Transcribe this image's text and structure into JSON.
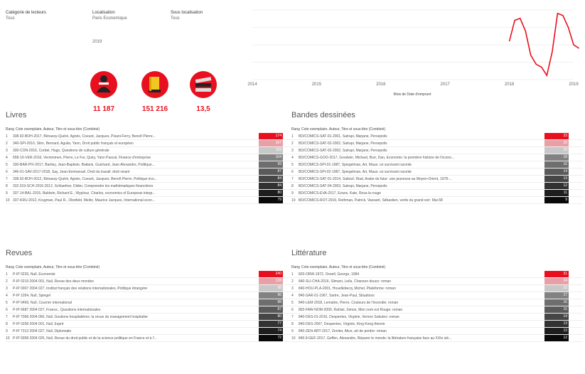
{
  "filters": [
    {
      "label": "Catégorie de lecteurs",
      "value": "Tous"
    },
    {
      "label": "Localisation",
      "value": "Paris Economique"
    },
    {
      "label": "Sous localisation",
      "value": "Tous"
    }
  ],
  "year": "2019",
  "kpis": [
    {
      "icon": "reader-person-icon",
      "value": "11 187"
    },
    {
      "icon": "book-icon",
      "value": "151 216"
    },
    {
      "icon": "books-stack-icon",
      "value": "13,5"
    }
  ],
  "chart_data": {
    "type": "line",
    "x_ticks": [
      "2014",
      "2015",
      "2016",
      "2017",
      "2018",
      "2019"
    ],
    "xlabel": "Mois de Date d'emprunt",
    "color": "#e8101f",
    "x": [
      "2018-01",
      "2018-02",
      "2018-03",
      "2018-04",
      "2018-05",
      "2018-06",
      "2018-07",
      "2018-08",
      "2018-09",
      "2018-10",
      "2018-11",
      "2018-12",
      "2019-01",
      "2019-02"
    ],
    "y": [
      0.55,
      0.85,
      0.88,
      0.7,
      0.35,
      0.22,
      0.18,
      0.06,
      0.4,
      0.95,
      0.92,
      0.75,
      0.5,
      0.45
    ]
  },
  "sections": [
    {
      "title": "Livres",
      "header_rank": "Rang",
      "header_text": "Cote exemplaire, Auteur, Titre et sous-titre (Combiné)",
      "rows": [
        {
          "rank": "1",
          "text": "338.92-BOH-2017, Bénassy-Quéré, Agnès, Coeuré, Jacques, Pisani-Ferry, Benoît Pierre...",
          "value": "174"
        },
        {
          "rank": "2",
          "text": "340-SPI-2016, Stirn, Bernard, Aguila, Yann, Droit public français et européen",
          "value": "167"
        },
        {
          "rank": "3",
          "text": "300-CON-2016, Corbel, Hugo, Questions de culture générale",
          "value": "115"
        },
        {
          "rank": "4",
          "text": "658-19-VER-2016, Vernimmen, Pierre, Le Fur, Quiry, Yann Pascal, Finance d'entreprise",
          "value": "104"
        },
        {
          "rank": "5",
          "text": "330-BAR-PIV-2017, Bartley, Jean-Baptiste, Baltaris, Guichard, Jean Alexandre, Politique...",
          "value": "99"
        },
        {
          "rank": "6",
          "text": "346-01-SAV-2017-2018, Say, Jean-Emmanuel, Droit du travail: droit vivant",
          "value": "87"
        },
        {
          "rank": "7",
          "text": "338.92-BOH-2012, Bénassy-Quéré, Agnès, Coeuré, Jacques, Benoît Pierre, Politique éco...",
          "value": "84"
        },
        {
          "rank": "8",
          "text": "332.019-SCH-2016-2012, Schlaefner, Didier, Comprendre les mathématiques financières",
          "value": "84"
        },
        {
          "rank": "9",
          "text": "337.14-BAL-2015, Baldwin, Richard E., Wyplosz, Charles, economics of European integr...",
          "value": "80"
        },
        {
          "rank": "10",
          "text": "337-KRU-2012, Krugman, Paul R., Obstfeld, Melitz, Maurice Jacques, International econ...",
          "value": "79"
        }
      ]
    },
    {
      "title": "Bandes dessinées",
      "header_rank": "Rang",
      "header_text": "Cote exemplaire, Auteur, Titre et sous-titre (Combiné)",
      "rows": [
        {
          "rank": "1",
          "text": "BD/COMICS-SAT-01-2001, Satrapi, Marjane, Persepolis",
          "value": "23"
        },
        {
          "rank": "2",
          "text": "BD/COMICS-SAT-02-2002, Satrapi, Marjane, Persepolis",
          "value": "20"
        },
        {
          "rank": "3",
          "text": "BD/COMICS-SAT-03-2002, Satrapi, Marjane, Persepolis",
          "value": "20"
        },
        {
          "rank": "4",
          "text": "BD/COMICS-GOO-2017, Goodwin, Michael, Burr, Dan, Economix: la première histoire de l'écono...",
          "value": "18"
        },
        {
          "rank": "5",
          "text": "BD/COMICS-SPI-01-1987, Spiegelman, Art, Maus: un survivant raconte",
          "value": "16"
        },
        {
          "rank": "6",
          "text": "BD/COMICS-SPI-02-1987, Spiegelman, Art, Maus: un survivant raconte",
          "value": "14"
        },
        {
          "rank": "7",
          "text": "BD/COMICS-SAT-01-2014, Sattouf, Riad, Arabe du futur: une jeunesse au Moyen-Orient, 1978-...",
          "value": "13"
        },
        {
          "rank": "8",
          "text": "BD/COMICS-SAT-04-2003, Satrapi, Marjane, Persepolis",
          "value": "12"
        },
        {
          "rank": "9",
          "text": "BD/COMICS-EVA-2017, Evans, Kate, Rosa la rouge",
          "value": "11"
        },
        {
          "rank": "10",
          "text": "BD/COMICS-ROT-2019, Rothman, Patrick, Vassant, Sébastien, vertis du grand soir: Mai 68",
          "value": "9"
        }
      ]
    },
    {
      "title": "Revues",
      "header_rank": "Rang",
      "header_text": "Cote exemplaire, Auteur, Titre et sous-titre (Combiné)",
      "rows": [
        {
          "rank": "1",
          "text": "P-IP 0226, Null, Economist",
          "value": "240"
        },
        {
          "rank": "2",
          "text": "P-IP 0219 2004 001, Null, Revue des deux mondes",
          "value": "128"
        },
        {
          "rank": "3",
          "text": "P-IP 0007 2004 027, Institut français des relations internationales, Politique étrangère",
          "value": "98"
        },
        {
          "rank": "4",
          "text": "P-IP 1054, Null, Spiegel",
          "value": "96"
        },
        {
          "rank": "5",
          "text": "P-IP 0469, Null, Courrier international",
          "value": "88"
        },
        {
          "rank": "6",
          "text": "P-IP 6687 2004 027, France., Questions internationales",
          "value": "87"
        },
        {
          "rank": "7",
          "text": "P-IP 7068 2004 060, Null, Gestions hospitalières: la revue du management hospitalier",
          "value": "80"
        },
        {
          "rank": "8",
          "text": "P-IP 0258 2004 001, Null, Esprit",
          "value": "77"
        },
        {
          "rank": "9",
          "text": "P-IP 7313 2004 027, Null, Diplomatie",
          "value": "74"
        },
        {
          "rank": "10",
          "text": "P-IP 0058 2004 025, Null, Revue du droit public et de la science politique en France et à l'...",
          "value": "72"
        }
      ]
    },
    {
      "title": "Littérature",
      "header_rank": "Rang",
      "header_text": "Cote exemplaire, Auteur, Titre et sous-titre (Combiné)",
      "rows": [
        {
          "rank": "1",
          "text": "820-ORW-1972, Orwell, George, 1984",
          "value": "31"
        },
        {
          "rank": "2",
          "text": "840-SLI-CHA-2016, Slimani, Leïla, Chanson douce: roman",
          "value": "24"
        },
        {
          "rank": "3",
          "text": "840-HOU-PLA-2001, Houellebecq, Michel, Plateforme: roman",
          "value": "22"
        },
        {
          "rank": "4",
          "text": "840-SAR-01-1967, Sartre, Jean-Paul, Situations",
          "value": "17"
        },
        {
          "rank": "5",
          "text": "840-LEM-2018, Lemaitre, Pierre, Couleurs de l'incendie: roman",
          "value": "16"
        },
        {
          "rank": "6",
          "text": "892-FAW-NOM-2009, Rahiwi, Simon, Mon nom est Rouge: roman",
          "value": "15"
        },
        {
          "rank": "7",
          "text": "840-DES-01-2016, Despentes, Virginie, Vernon Subutex: roman",
          "value": "14"
        },
        {
          "rank": "8",
          "text": "840-DES-2007, Despentes, Virginie, King Kong théorie",
          "value": "13"
        },
        {
          "rank": "9",
          "text": "840-ZEN-ART-2017, Zeniter, Alice, art de perdre: roman",
          "value": "13"
        },
        {
          "rank": "10",
          "text": "840.9-GEF-2017, Geffen, Alexandre, Réparer le monde: la littérature française face au XXIe siè...",
          "value": "12"
        }
      ]
    }
  ]
}
